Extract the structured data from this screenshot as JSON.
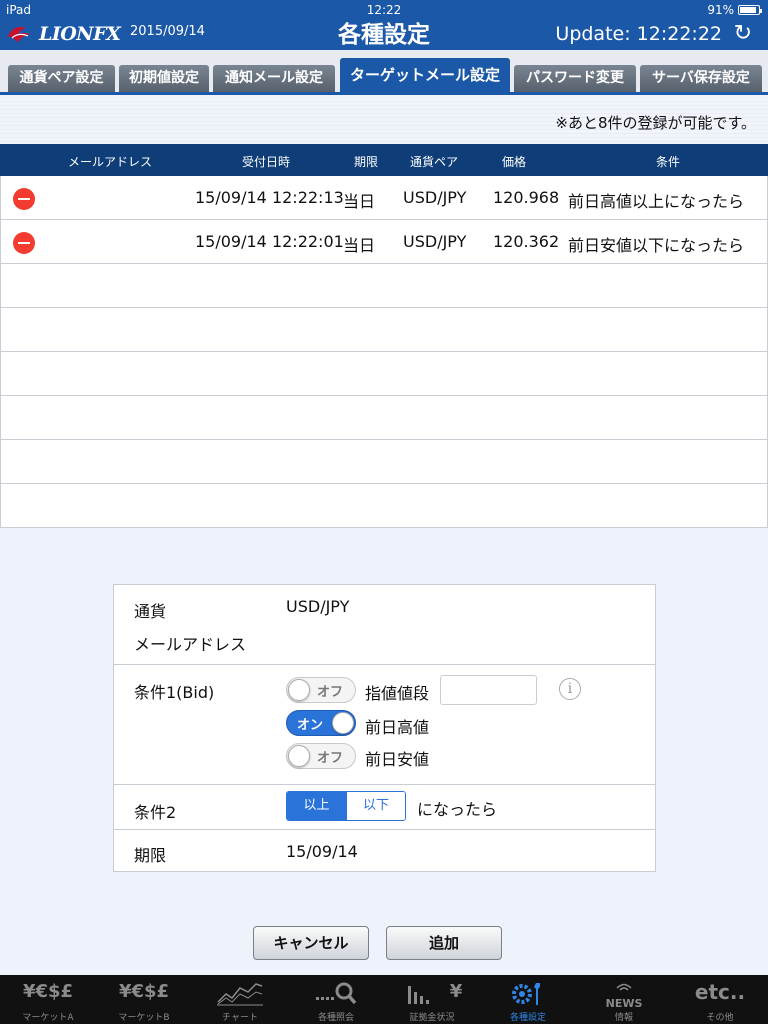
{
  "status": {
    "device": "iPad",
    "time": "12:22",
    "battery": "91%",
    "battery_level": 0.91
  },
  "header": {
    "logo": "LIONFX",
    "date": "2015/09/14",
    "title": "各種設定",
    "update": "Update: 12:22:22"
  },
  "tabs": [
    {
      "label": "通貨ペア設定"
    },
    {
      "label": "初期値設定"
    },
    {
      "label": "通知メール設定"
    },
    {
      "label": "ターゲットメール設定",
      "active": true
    },
    {
      "label": "パスワード変更"
    },
    {
      "label": "サーバ保存設定"
    }
  ],
  "notice": "※あと8件の登録が可能です。",
  "table": {
    "headers": [
      "メールアドレス",
      "受付日時",
      "期限",
      "通貨ペア",
      "価格",
      "条件"
    ],
    "rows": [
      {
        "email": "",
        "datetime": "15/09/14 12:22:13",
        "expiry": "当日",
        "pair": "USD/JPY",
        "price": "120.968",
        "condition": "前日高値以上になったら"
      },
      {
        "email": "",
        "datetime": "15/09/14 12:22:01",
        "expiry": "当日",
        "pair": "USD/JPY",
        "price": "120.362",
        "condition": "前日安値以下になったら"
      }
    ]
  },
  "form": {
    "currency_label": "通貨",
    "currency_value": "USD/JPY",
    "email_label": "メールアドレス",
    "email_value": "",
    "cond1_label": "条件1(Bid)",
    "toggle_off": "オフ",
    "toggle_on": "オン",
    "limit_price_label": "指値値段",
    "limit_price_value": "",
    "prev_high_label": "前日高値",
    "prev_low_label": "前日安値",
    "cond2_label": "条件2",
    "above": "以上",
    "below": "以下",
    "cond2_suffix": "になったら",
    "expiry_label": "期限",
    "expiry_value": "15/09/14"
  },
  "buttons": {
    "cancel": "キャンセル",
    "add": "追加"
  },
  "tabbar": [
    {
      "icon": "¥€$£",
      "label": "マーケットA"
    },
    {
      "icon": "¥€$£",
      "label": "マーケットB"
    },
    {
      "icon": "chart-icon",
      "label": "チャート"
    },
    {
      "icon": "search-icon",
      "label": "各種照会"
    },
    {
      "icon": "¥",
      "label": "証拠金状況"
    },
    {
      "icon": "gear-wrench-icon",
      "label": "各種設定",
      "active": true
    },
    {
      "icon": "NEWS",
      "label": "情報"
    },
    {
      "icon": "etc..",
      "label": "その他"
    }
  ],
  "colors": {
    "brand": "#1b58a8",
    "table_header": "#0e3d78",
    "accent": "#2a73d9",
    "delete": "#f33b2f"
  }
}
